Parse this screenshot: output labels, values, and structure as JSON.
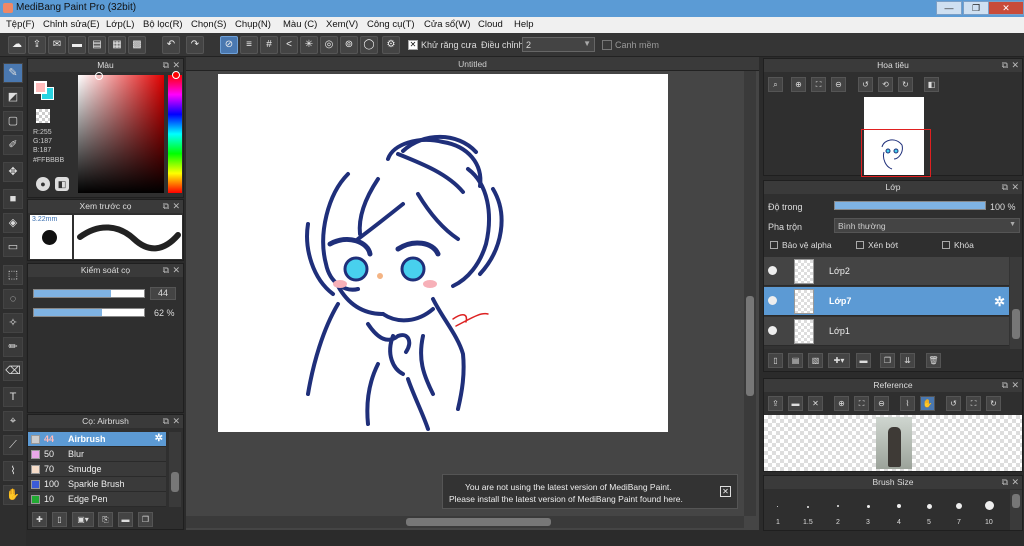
{
  "titlebar": {
    "title": "MediBang Paint Pro (32bit)"
  },
  "menu": [
    "Tệp(F)",
    "Chỉnh sửa(E)",
    "Lớp(L)",
    "Bộ lọc(R)",
    "Chọn(S)",
    "Chụp(N)",
    "Màu (C)",
    "Xem(V)",
    "Công cụ(T)",
    "Cửa sổ(W)",
    "Cloud",
    "Help"
  ],
  "toolbar": {
    "antialias_label": "Khử răng cưa",
    "correction_label": "Điều chỉnh",
    "correction_value": "2",
    "snap_label": "Canh mềm"
  },
  "canvas": {
    "tab": "Untitled"
  },
  "color_panel": {
    "title": "Màu",
    "r": "R:255",
    "g": "G:187",
    "b": "B:187",
    "hex": "#FFBBBB"
  },
  "brush_preview": {
    "title": "Xem trước cọ",
    "size": "3.22mm"
  },
  "brush_control": {
    "title": "Kiểm soát cọ",
    "size_value": "44",
    "opacity_value": "62 %",
    "size_fraction": 0.7,
    "opacity_fraction": 0.62
  },
  "brush_list": {
    "title": "Cọ: Airbrush",
    "items": [
      {
        "size": "44",
        "name": "Airbrush",
        "color": "#cccccc"
      },
      {
        "size": "50",
        "name": "Blur",
        "color": "#e8a8e8"
      },
      {
        "size": "70",
        "name": "Smudge",
        "color": "#f6dcc8"
      },
      {
        "size": "100",
        "name": "Sparkle Brush",
        "color": "#3a5bd8"
      },
      {
        "size": "10",
        "name": "Edge Pen",
        "color": "#22aa33"
      }
    ]
  },
  "navigator": {
    "title": "Hoa tiêu"
  },
  "layer_panel": {
    "title": "Lớp",
    "opacity_label": "Độ trong",
    "opacity_value": "100 %",
    "opacity_fraction": 1.0,
    "blend_label": "Pha trộn",
    "blend_value": "Bình thường",
    "protect_alpha": "Bảo vệ alpha",
    "clipping": "Xén bớt",
    "lock": "Khóa",
    "layers": [
      "Lớp2",
      "Lớp7",
      "Lớp1"
    ]
  },
  "reference": {
    "title": "Reference"
  },
  "brush_size": {
    "title": "Brush Size",
    "sizes": [
      "1",
      "1.5",
      "2",
      "3",
      "4",
      "5",
      "7",
      "10"
    ]
  },
  "notice": {
    "line1": "You are not using the latest version of MediBang Paint.",
    "line2": "Please install the latest version of MediBang Paint found here."
  },
  "colors": {
    "accent": "#5c9ad4",
    "primary": "#FFBBBB",
    "drawing": "#1f2f7a"
  }
}
